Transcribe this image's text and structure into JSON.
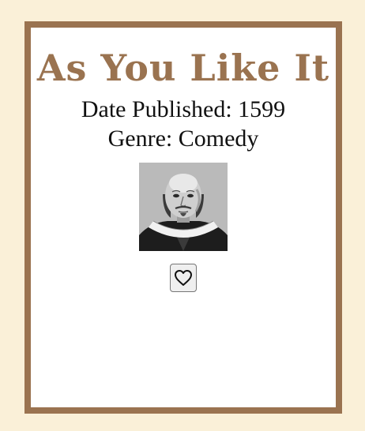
{
  "book": {
    "title": "As You Like It",
    "date_published": "Date Published: 1599",
    "genre": "Genre: Comedy"
  },
  "icons": {
    "portrait": "shakespeare-portrait",
    "favorite": "heart-outline-icon"
  },
  "colors": {
    "page_background": "#faf0d8",
    "card_border": "#9a7350",
    "title": "#9a7350"
  }
}
